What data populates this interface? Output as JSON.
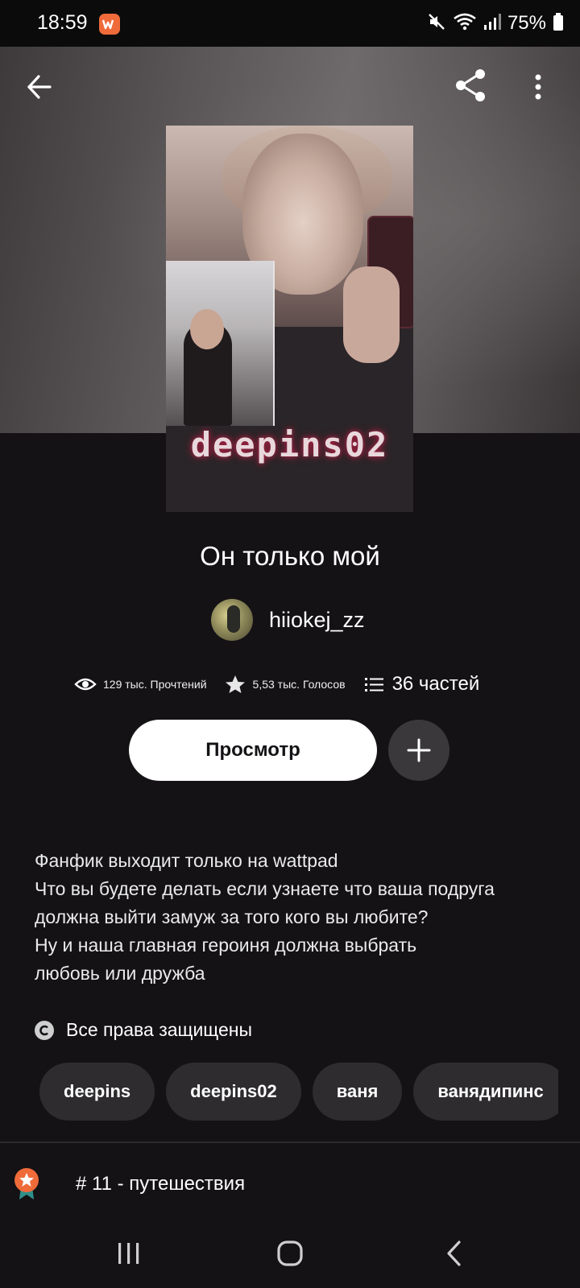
{
  "status_bar": {
    "time": "18:59",
    "battery_percent": "75%",
    "icons": [
      "mute-icon",
      "wifi-icon",
      "signal-icon",
      "battery-icon"
    ],
    "notification_app_icon": "wattpad-icon",
    "notification_icon_color": "#ef6b3a"
  },
  "header": {
    "back_icon": "back-arrow-icon",
    "share_icon": "share-icon",
    "more_icon": "more-vertical-icon"
  },
  "cover": {
    "watermark_text": "deepins02"
  },
  "story": {
    "title": "Он только мой",
    "author": "hiiokej_zz",
    "stats": {
      "reads": "129 тыс. Прочтений",
      "votes": "5,53 тыс. Голосов",
      "parts": "36 частей"
    },
    "view_button_label": "Просмотр",
    "description_lines": [
      "Фанфик выходит только на wattpad",
      "Что вы будете делать если узнаете что ваша подруга",
      "должна выйти замуж за того кого вы любите?",
      "Ну и наша главная героиня должна выбрать",
      "любовь или дружба"
    ],
    "copyright": "Все права защищены",
    "tags": [
      "deepins",
      "deepins02",
      "ваня",
      "ванядипинс"
    ],
    "ranking": "# 11 - путешествия"
  },
  "nav_bar": {
    "icons": [
      "recent-apps-icon",
      "home-icon",
      "nav-back-icon"
    ]
  },
  "colors": {
    "background": "#141215",
    "button_bg": "#ffffff",
    "chip_bg": "#2e2c2f",
    "ranking_badge": "#ef6b3a"
  }
}
